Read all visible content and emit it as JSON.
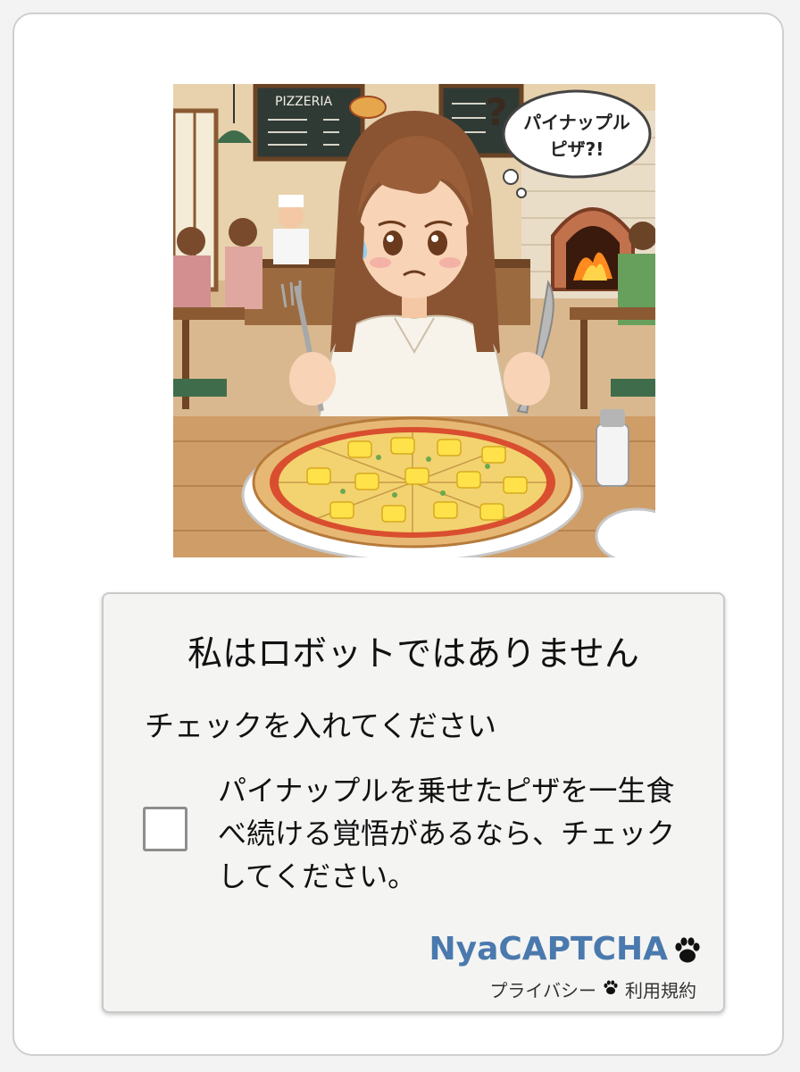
{
  "illustration": {
    "menu_board_title": "PIZZERIA",
    "speech_bubble_line1": "パイナップル",
    "speech_bubble_line2": "ピザ?!",
    "question_mark": "?"
  },
  "captcha": {
    "title": "私はロボットではありません",
    "instruction": "チェックを入れてください",
    "checkbox_label_lines": [
      "パイナップルを乗せたピザを一生食",
      "べ続ける覚悟があるなら、チェック",
      "してください。"
    ],
    "checkbox_checked": false,
    "brand": "NyaCAPTCHA",
    "privacy_link": "プライバシー",
    "terms_link": "利用規約"
  },
  "colors": {
    "brand_blue": "#4a79ad",
    "paw_black": "#111111"
  },
  "icons": [
    "paw-icon",
    "paw-separator-icon"
  ]
}
